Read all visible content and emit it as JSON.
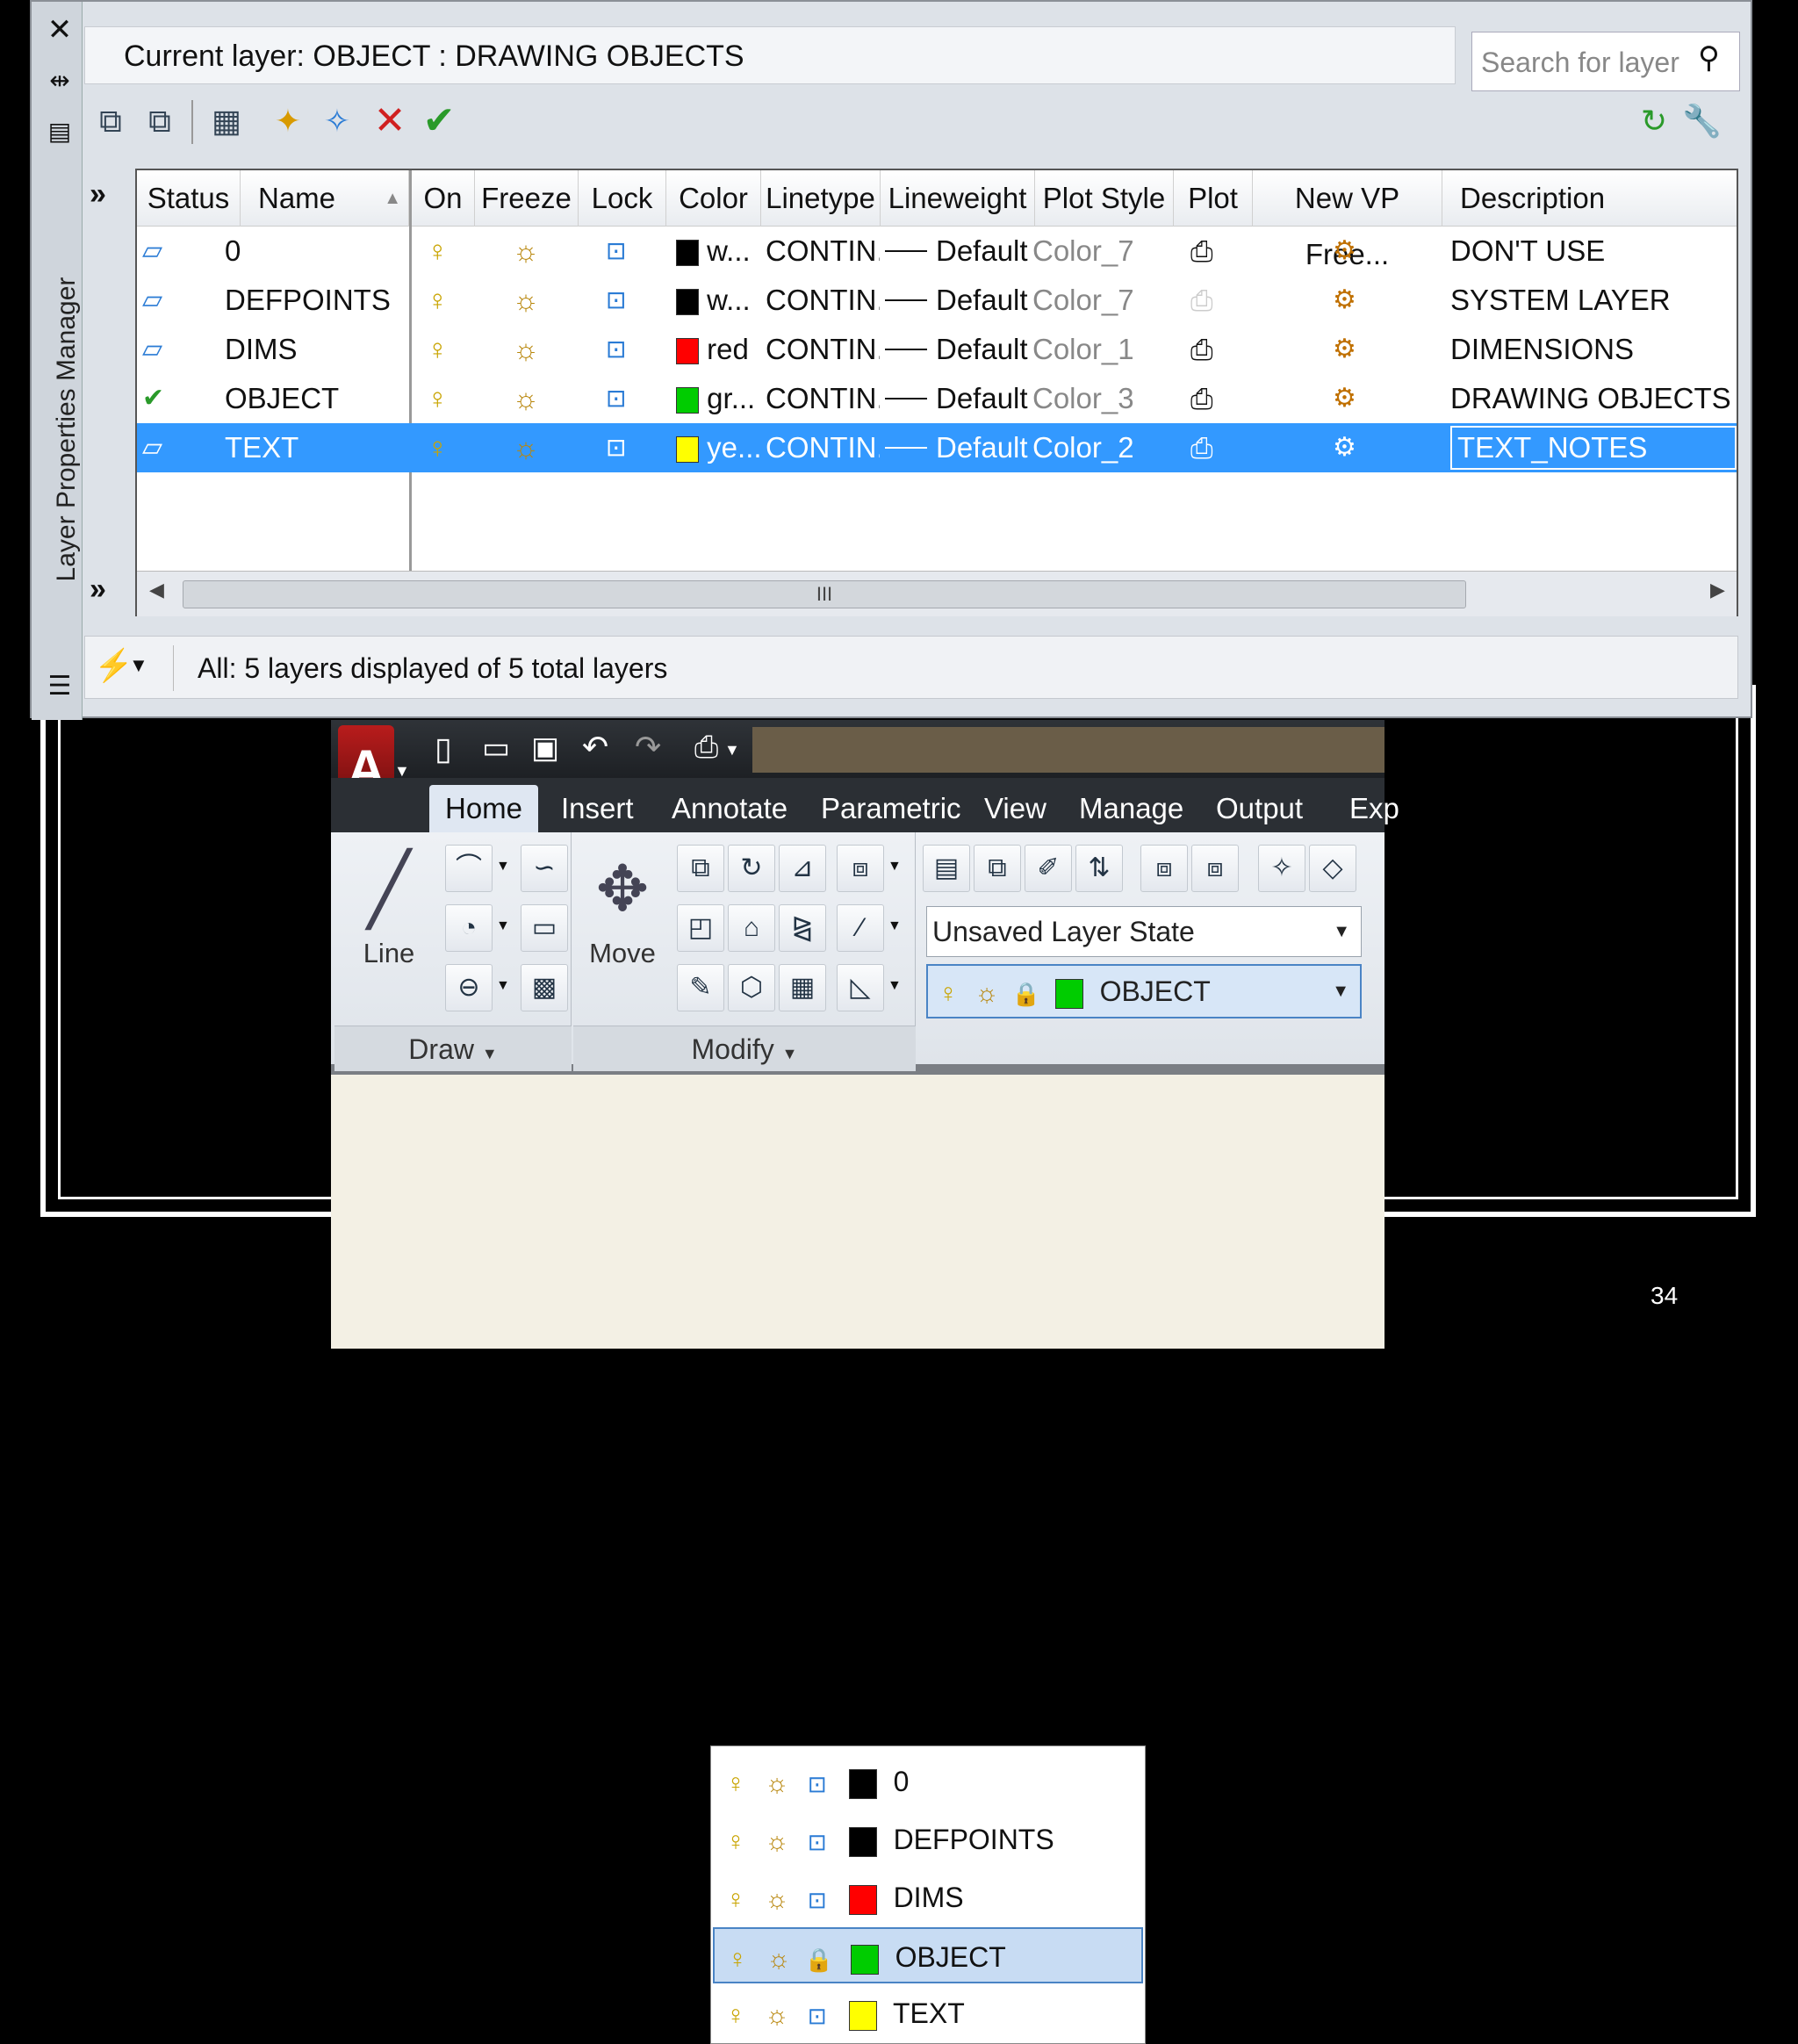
{
  "page": {
    "number": "34"
  },
  "layer_manager": {
    "side_title": "Layer Properties Manager",
    "current_layer": "Current layer: OBJECT : DRAWING OBJECTS",
    "search_placeholder": "Search for layer",
    "columns": [
      "Status",
      "Name",
      "On",
      "Freeze",
      "Lock",
      "Color",
      "Linetype",
      "Lineweight",
      "Plot Style",
      "Plot",
      "New VP Free...",
      "Description"
    ],
    "rows": [
      {
        "status": "layer-icon",
        "name": "0",
        "color_swatch": "#000000",
        "color": "w...",
        "linetype": "CONTIN...",
        "lineweight": "Default",
        "plot_style": "Color_7",
        "description": "DON'T USE",
        "plot_enabled": true,
        "selected": false
      },
      {
        "status": "layer-icon",
        "name": "DEFPOINTS",
        "color_swatch": "#000000",
        "color": "w...",
        "linetype": "CONTIN...",
        "lineweight": "Default",
        "plot_style": "Color_7",
        "description": "SYSTEM LAYER",
        "plot_enabled": false,
        "selected": false
      },
      {
        "status": "layer-icon",
        "name": "DIMS",
        "color_swatch": "#ff0000",
        "color": "red",
        "linetype": "CONTIN...",
        "lineweight": "Default",
        "plot_style": "Color_1",
        "description": "DIMENSIONS",
        "plot_enabled": true,
        "selected": false
      },
      {
        "status": "current-check-icon",
        "name": "OBJECT",
        "color_swatch": "#00cc00",
        "color": "gr...",
        "linetype": "CONTIN...",
        "lineweight": "Default",
        "plot_style": "Color_3",
        "description": "DRAWING OBJECTS",
        "plot_enabled": true,
        "selected": false
      },
      {
        "status": "layer-icon",
        "name": "TEXT",
        "color_swatch": "#ffff00",
        "color": "ye...",
        "linetype": "CONTIN...",
        "lineweight": "Default",
        "plot_style": "Color_2",
        "description": "TEXT_NOTES",
        "plot_enabled": true,
        "selected": true
      }
    ],
    "status_text": "All: 5 layers displayed of 5 total layers",
    "scroll_thumb": "III"
  },
  "ribbon": {
    "tabs": [
      "Home",
      "Insert",
      "Annotate",
      "Parametric",
      "View",
      "Manage",
      "Output",
      "Exp"
    ],
    "active_tab": "Home",
    "draw": {
      "line_label": "Line",
      "footer": "Draw"
    },
    "modify": {
      "move_label": "Move",
      "footer": "Modify"
    },
    "layer_state": "Unsaved Layer State",
    "current_layer": {
      "name": "OBJECT",
      "color": "#00cc00"
    },
    "dropdown": [
      {
        "name": "0",
        "color": "#000000",
        "locked": false
      },
      {
        "name": "DEFPOINTS",
        "color": "#000000",
        "locked": false
      },
      {
        "name": "DIMS",
        "color": "#ff0000",
        "locked": false
      },
      {
        "name": "OBJECT",
        "color": "#00cc00",
        "locked": true,
        "highlighted": true
      },
      {
        "name": "TEXT",
        "color": "#ffff00",
        "locked": false
      }
    ]
  }
}
